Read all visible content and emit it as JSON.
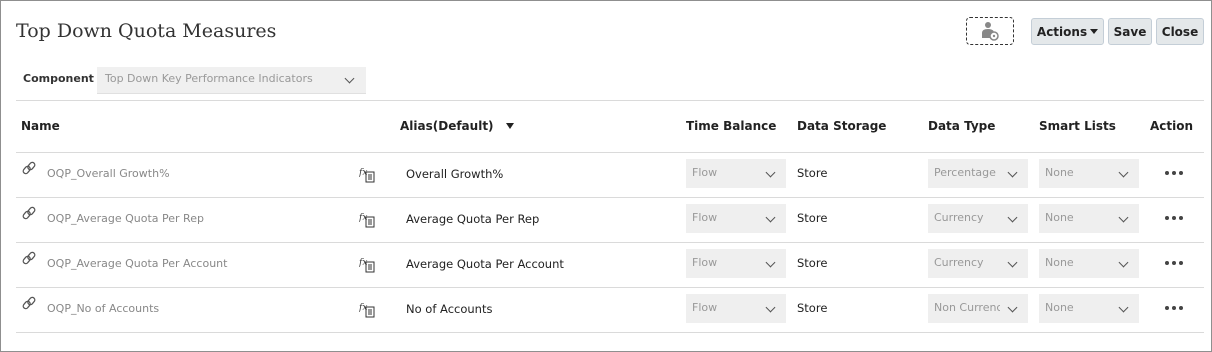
{
  "page": {
    "title": "Top Down Quota Measures"
  },
  "toolbar": {
    "user_icon": "user-settings-icon",
    "actions_label": "Actions",
    "save_label": "Save",
    "close_label": "Close"
  },
  "component": {
    "label": "Component",
    "value": "Top Down Key Performance Indicators"
  },
  "table": {
    "headers": {
      "name": "Name",
      "alias": "Alias(Default)",
      "time_balance": "Time Balance",
      "data_storage": "Data Storage",
      "data_type": "Data Type",
      "smart_lists": "Smart Lists",
      "action": "Action"
    },
    "rows": [
      {
        "name": "OQP_Overall Growth%",
        "alias": "Overall Growth%",
        "time_balance": "Flow",
        "data_storage": "Store",
        "data_type": "Percentage",
        "smart_list": "None"
      },
      {
        "name": "OQP_Average Quota Per Rep",
        "alias": "Average Quota Per Rep",
        "time_balance": "Flow",
        "data_storage": "Store",
        "data_type": "Currency",
        "smart_list": "None"
      },
      {
        "name": "OQP_Average Quota Per Account",
        "alias": "Average Quota Per Account",
        "time_balance": "Flow",
        "data_storage": "Store",
        "data_type": "Currency",
        "smart_list": "None"
      },
      {
        "name": "OQP_No of Accounts",
        "alias": "No of Accounts",
        "time_balance": "Flow",
        "data_storage": "Store",
        "data_type": "Non Currency",
        "smart_list": "None"
      }
    ]
  },
  "icons": {
    "row_link": "link-icon",
    "row_formula": "formula-icon",
    "row_action": "more-actions-icon"
  }
}
